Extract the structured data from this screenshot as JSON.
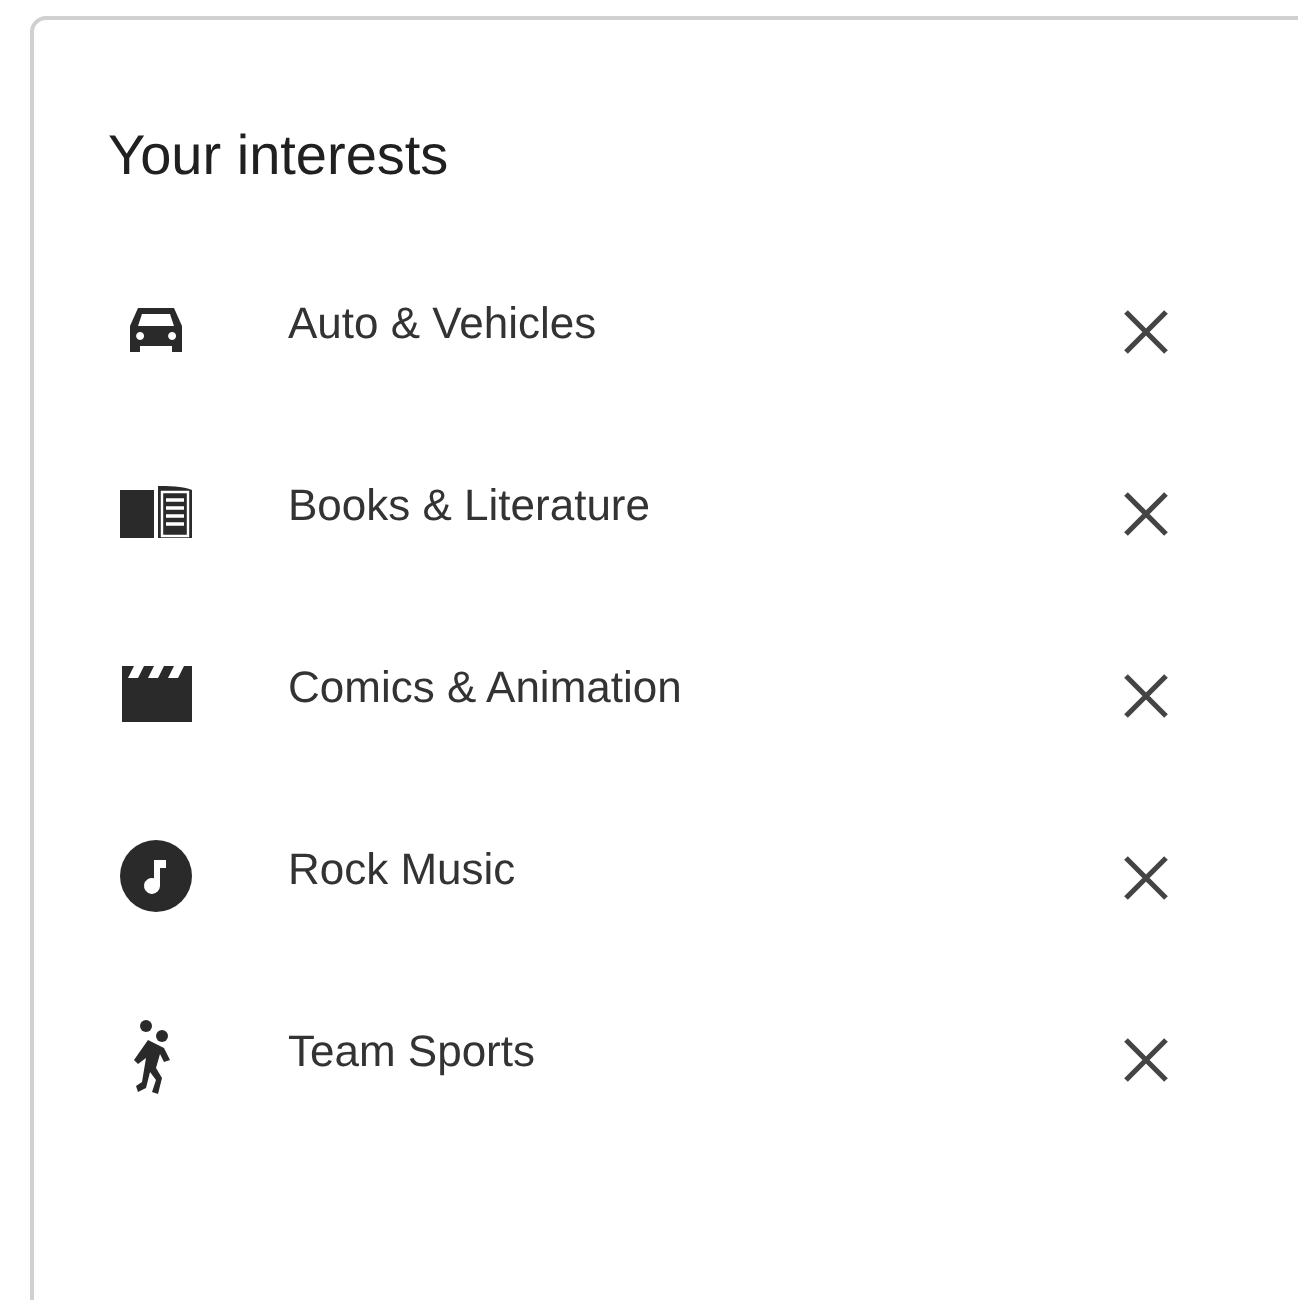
{
  "title": "Your interests",
  "interests": [
    {
      "label": "Auto & Vehicles"
    },
    {
      "label": "Books & Literature"
    },
    {
      "label": "Comics & Animation"
    },
    {
      "label": "Rock Music"
    },
    {
      "label": "Team Sports"
    }
  ]
}
